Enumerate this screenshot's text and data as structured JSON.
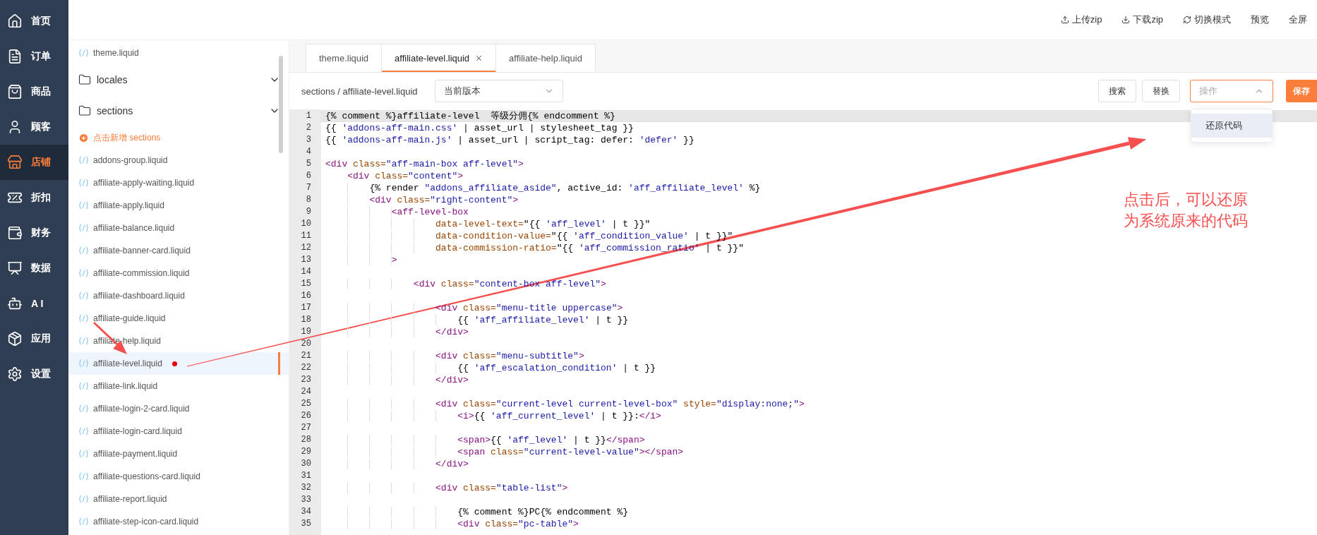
{
  "nav": {
    "items": [
      {
        "label": "首页",
        "selected": false
      },
      {
        "label": "订单",
        "selected": false
      },
      {
        "label": "商品",
        "selected": false
      },
      {
        "label": "顾客",
        "selected": false
      },
      {
        "label": "店铺",
        "selected": true
      },
      {
        "label": "折扣",
        "selected": false
      },
      {
        "label": "财务",
        "selected": false
      },
      {
        "label": "数据",
        "selected": false
      },
      {
        "label": "A I",
        "selected": false
      },
      {
        "label": "应用",
        "selected": false
      },
      {
        "label": "设置",
        "selected": false
      }
    ]
  },
  "top_actions": [
    "上传zip",
    "下载zip",
    "切换模式",
    "预览",
    "全屏"
  ],
  "file_tree": [
    {
      "kind": "file",
      "name": "theme.liquid",
      "selected": false,
      "modified": false
    },
    {
      "kind": "folder",
      "name": "locales"
    },
    {
      "kind": "folder",
      "name": "sections",
      "children": [
        {
          "kind": "add",
          "name": "点击新增 sections"
        },
        {
          "kind": "file",
          "name": "addons-group.liquid",
          "selected": false,
          "modified": false
        },
        {
          "kind": "file",
          "name": "affiliate-apply-waiting.liquid",
          "selected": false,
          "modified": false
        },
        {
          "kind": "file",
          "name": "affiliate-apply.liquid",
          "selected": false,
          "modified": false
        },
        {
          "kind": "file",
          "name": "affiliate-balance.liquid",
          "selected": false,
          "modified": false
        },
        {
          "kind": "file",
          "name": "affiliate-banner-card.liquid",
          "selected": false,
          "modified": false
        },
        {
          "kind": "file",
          "name": "affiliate-commission.liquid",
          "selected": false,
          "modified": false
        },
        {
          "kind": "file",
          "name": "affiliate-dashboard.liquid",
          "selected": false,
          "modified": false
        },
        {
          "kind": "file",
          "name": "affiliate-guide.liquid",
          "selected": false,
          "modified": false
        },
        {
          "kind": "file",
          "name": "affiliate-help.liquid",
          "selected": false,
          "modified": false
        },
        {
          "kind": "file",
          "name": "affiliate-level.liquid",
          "selected": true,
          "modified": true
        },
        {
          "kind": "file",
          "name": "affiliate-link.liquid",
          "selected": false,
          "modified": false
        },
        {
          "kind": "file",
          "name": "affiliate-login-2-card.liquid",
          "selected": false,
          "modified": false
        },
        {
          "kind": "file",
          "name": "affiliate-login-card.liquid",
          "selected": false,
          "modified": false
        },
        {
          "kind": "file",
          "name": "affiliate-payment.liquid",
          "selected": false,
          "modified": false
        },
        {
          "kind": "file",
          "name": "affiliate-questions-card.liquid",
          "selected": false,
          "modified": false
        },
        {
          "kind": "file",
          "name": "affiliate-report.liquid",
          "selected": false,
          "modified": false
        },
        {
          "kind": "file",
          "name": "affiliate-step-icon-card.liquid",
          "selected": false,
          "modified": false
        }
      ]
    }
  ],
  "editor_tabs": [
    {
      "label": "theme.liquid",
      "selected": false
    },
    {
      "label": "affiliate-level.liquid",
      "selected": true
    },
    {
      "label": "affiliate-help.liquid",
      "selected": false
    }
  ],
  "toolbar": {
    "path": "sections / affiliate-level.liquid",
    "version_select": {
      "value": "当前版本"
    },
    "buttons": [
      "搜索",
      "替换"
    ],
    "action_select": {
      "placeholder": "操作",
      "expanded": true,
      "menu": [
        {
          "label": "还原代码",
          "highlighted": true
        }
      ]
    },
    "save_button": "保存"
  },
  "code": {
    "lines": [
      {
        "n": "1",
        "current": true,
        "tokens": [
          {
            "kind": "plain",
            "text": "{% comment %}affiliate-level  等级分佣{% endcomment %}"
          }
        ]
      },
      {
        "n": "2",
        "current": false,
        "tokens": [
          {
            "kind": "plain",
            "text": "{{ "
          },
          {
            "kind": "string",
            "text": "'addons-aff-main.css'"
          },
          {
            "kind": "plain",
            "text": " | asset_url | stylesheet_tag }}"
          }
        ]
      },
      {
        "n": "3",
        "current": false,
        "tokens": [
          {
            "kind": "plain",
            "text": "{{ "
          },
          {
            "kind": "string",
            "text": "'addons-aff-main.js'"
          },
          {
            "kind": "plain",
            "text": " | asset_url | script_tag: defer: "
          },
          {
            "kind": "string",
            "text": "'defer'"
          },
          {
            "kind": "plain",
            "text": " }}"
          }
        ]
      },
      {
        "n": "4",
        "current": false
      },
      {
        "n": "5",
        "current": false,
        "tokens": [
          {
            "kind": "tag",
            "text": "<div"
          },
          {
            "kind": "attr",
            "text": " class="
          },
          {
            "kind": "string",
            "text": "\"aff-main-box aff-level\""
          },
          {
            "kind": "tag",
            "text": ">"
          }
        ]
      },
      {
        "n": "6",
        "current": false,
        "tokens": [
          {
            "kind": "tag",
            "text": "    <div"
          },
          {
            "kind": "attr",
            "text": " class="
          },
          {
            "kind": "string",
            "text": "\"content\""
          },
          {
            "kind": "tag",
            "text": ">"
          }
        ]
      },
      {
        "n": "7",
        "current": false,
        "tokens": [
          {
            "kind": "plain",
            "text": "        {% render "
          },
          {
            "kind": "string",
            "text": "\"addons_affiliate_aside\""
          },
          {
            "kind": "plain",
            "text": ", active_id: "
          },
          {
            "kind": "string",
            "text": "'aff_affiliate_level'"
          },
          {
            "kind": "plain",
            "text": " %}"
          }
        ]
      },
      {
        "n": "8",
        "current": false,
        "tokens": [
          {
            "kind": "tag",
            "text": "        <div"
          },
          {
            "kind": "attr",
            "text": " class="
          },
          {
            "kind": "string",
            "text": "\"right-content\""
          },
          {
            "kind": "tag",
            "text": ">"
          }
        ]
      },
      {
        "n": "9",
        "current": false,
        "tokens": [
          {
            "kind": "tag",
            "text": "            <aff-level-box"
          }
        ]
      },
      {
        "n": "10",
        "current": false,
        "tokens": [
          {
            "kind": "attr",
            "text": "                    data-level-text="
          },
          {
            "kind": "plain",
            "text": "\"{{ "
          },
          {
            "kind": "string",
            "text": "'aff_level'"
          },
          {
            "kind": "plain",
            "text": " | t }}\""
          }
        ]
      },
      {
        "n": "11",
        "current": false,
        "tokens": [
          {
            "kind": "attr",
            "text": "                    data-condition-value="
          },
          {
            "kind": "plain",
            "text": "\"{{ "
          },
          {
            "kind": "string",
            "text": "'aff_condition_value'"
          },
          {
            "kind": "plain",
            "text": " | t }}\""
          }
        ]
      },
      {
        "n": "12",
        "current": false,
        "tokens": [
          {
            "kind": "attr",
            "text": "                    data-commission-ratio="
          },
          {
            "kind": "plain",
            "text": "\"{{ "
          },
          {
            "kind": "string",
            "text": "'aff_commission_ratio'"
          },
          {
            "kind": "plain",
            "text": " | t }}\""
          }
        ]
      },
      {
        "n": "13",
        "current": false,
        "tokens": [
          {
            "kind": "tag",
            "text": "            >"
          }
        ]
      },
      {
        "n": "14",
        "current": false
      },
      {
        "n": "15",
        "current": false,
        "tokens": [
          {
            "kind": "tag",
            "text": "                <div"
          },
          {
            "kind": "attr",
            "text": " class="
          },
          {
            "kind": "string",
            "text": "\"content-box aff-level\""
          },
          {
            "kind": "tag",
            "text": ">"
          }
        ]
      },
      {
        "n": "16",
        "current": false
      },
      {
        "n": "17",
        "current": false,
        "tokens": [
          {
            "kind": "tag",
            "text": "                    <div"
          },
          {
            "kind": "attr",
            "text": " class="
          },
          {
            "kind": "string",
            "text": "\"menu-title uppercase\""
          },
          {
            "kind": "tag",
            "text": ">"
          }
        ]
      },
      {
        "n": "18",
        "current": false,
        "tokens": [
          {
            "kind": "plain",
            "text": "                        {{ "
          },
          {
            "kind": "string",
            "text": "'aff_affiliate_level'"
          },
          {
            "kind": "plain",
            "text": " | t }}"
          }
        ]
      },
      {
        "n": "19",
        "current": false,
        "tokens": [
          {
            "kind": "tag",
            "text": "                    </div>"
          }
        ]
      },
      {
        "n": "20",
        "current": false
      },
      {
        "n": "21",
        "current": false,
        "tokens": [
          {
            "kind": "tag",
            "text": "                    <div"
          },
          {
            "kind": "attr",
            "text": " class="
          },
          {
            "kind": "string",
            "text": "\"menu-subtitle\""
          },
          {
            "kind": "tag",
            "text": ">"
          }
        ]
      },
      {
        "n": "22",
        "current": false,
        "tokens": [
          {
            "kind": "plain",
            "text": "                        {{ "
          },
          {
            "kind": "string",
            "text": "'aff_escalation_condition'"
          },
          {
            "kind": "plain",
            "text": " | t }}"
          }
        ]
      },
      {
        "n": "23",
        "current": false,
        "tokens": [
          {
            "kind": "tag",
            "text": "                    </div>"
          }
        ]
      },
      {
        "n": "24",
        "current": false
      },
      {
        "n": "25",
        "current": false,
        "tokens": [
          {
            "kind": "tag",
            "text": "                    <div"
          },
          {
            "kind": "attr",
            "text": " class="
          },
          {
            "kind": "string",
            "text": "\"current-level current-level-box\""
          },
          {
            "kind": "attr",
            "text": " style="
          },
          {
            "kind": "string",
            "text": "\"display:none;\""
          },
          {
            "kind": "tag",
            "text": ">"
          }
        ]
      },
      {
        "n": "26",
        "current": false,
        "tokens": [
          {
            "kind": "tag",
            "text": "                        <i>"
          },
          {
            "kind": "plain",
            "text": "{{ "
          },
          {
            "kind": "string",
            "text": "'aff_current_level'"
          },
          {
            "kind": "plain",
            "text": " | t }}:"
          },
          {
            "kind": "tag",
            "text": "</i>"
          }
        ]
      },
      {
        "n": "27",
        "current": false
      },
      {
        "n": "28",
        "current": false,
        "tokens": [
          {
            "kind": "tag",
            "text": "                        <span>"
          },
          {
            "kind": "plain",
            "text": "{{ "
          },
          {
            "kind": "string",
            "text": "'aff_level'"
          },
          {
            "kind": "plain",
            "text": " | t }}"
          },
          {
            "kind": "tag",
            "text": "</span>"
          }
        ]
      },
      {
        "n": "29",
        "current": false,
        "tokens": [
          {
            "kind": "tag",
            "text": "                        <span"
          },
          {
            "kind": "attr",
            "text": " class="
          },
          {
            "kind": "string",
            "text": "\"current-level-value\""
          },
          {
            "kind": "tag",
            "text": "></span>"
          }
        ]
      },
      {
        "n": "30",
        "current": false,
        "tokens": [
          {
            "kind": "tag",
            "text": "                    </div>"
          }
        ]
      },
      {
        "n": "31",
        "current": false
      },
      {
        "n": "32",
        "current": false,
        "tokens": [
          {
            "kind": "tag",
            "text": "                    <div"
          },
          {
            "kind": "attr",
            "text": " class="
          },
          {
            "kind": "string",
            "text": "\"table-list\""
          },
          {
            "kind": "tag",
            "text": ">"
          }
        ]
      },
      {
        "n": "33",
        "current": false
      },
      {
        "n": "34",
        "current": false,
        "tokens": [
          {
            "kind": "plain",
            "text": "                        {% comment %}PC{% endcomment %}"
          }
        ]
      },
      {
        "n": "35",
        "current": false,
        "tokens": [
          {
            "kind": "tag",
            "text": "                        <div"
          },
          {
            "kind": "attr",
            "text": " class="
          },
          {
            "kind": "string",
            "text": "\"pc-table\""
          },
          {
            "kind": "tag",
            "text": ">"
          }
        ]
      }
    ]
  },
  "annotation": {
    "lines": [
      "点击后，可以还原",
      "为系统原来的代码"
    ]
  }
}
